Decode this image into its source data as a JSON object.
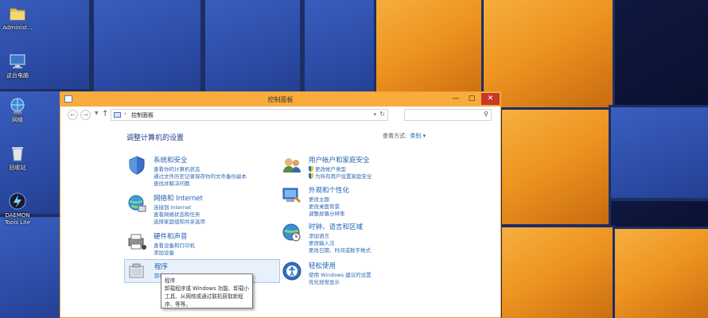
{
  "desktop": {
    "icons": [
      {
        "label": "Administ...",
        "icon": "folder-icon"
      },
      {
        "label": "这台电脑",
        "icon": "computer-icon"
      },
      {
        "label": "网络",
        "icon": "network-icon"
      },
      {
        "label": "回收站",
        "icon": "recycle-bin-icon"
      },
      {
        "label": "DAEMON Tools Lite",
        "icon": "daemon-tools-icon"
      }
    ]
  },
  "window": {
    "title": "控制面板",
    "buttons": {
      "minimize": "—",
      "maximize": "□",
      "close": "✕"
    },
    "address": {
      "path": "控制面板",
      "separator": "›"
    },
    "search": {
      "placeholder": ""
    },
    "heading": "调整计算机的设置",
    "view_by": {
      "label": "查看方式:",
      "value": "类别 ▾"
    },
    "categories": [
      {
        "title": "系统和安全",
        "icon": "shield-icon",
        "links": [
          "查看你的计算机状态",
          "通过文件历史记录保存你的文件备份副本",
          "查找并解决问题"
        ]
      },
      {
        "title": "网络和 Internet",
        "icon": "globe-network-icon",
        "links": [
          "连接到 Internet",
          "查看网络状态和任务",
          "选择家庭组和共享选项"
        ]
      },
      {
        "title": "硬件和声音",
        "icon": "printer-icon",
        "links": [
          "查看设备和打印机",
          "添加设备"
        ]
      },
      {
        "title": "程序",
        "icon": "programs-icon",
        "links": [
          "卸载程序"
        ]
      },
      {
        "title": "用户帐户和家庭安全",
        "icon": "users-icon",
        "links": [
          "更改帐户类型",
          "为所有用户设置家庭安全"
        ]
      },
      {
        "title": "外观和个性化",
        "icon": "appearance-icon",
        "links": [
          "更改主题",
          "更改桌面背景",
          "调整屏幕分辨率"
        ]
      },
      {
        "title": "时钟、语言和区域",
        "icon": "clock-globe-icon",
        "links": [
          "添加语言",
          "更改输入法",
          "更改日期、时间或数字格式"
        ]
      },
      {
        "title": "轻松使用",
        "icon": "ease-of-access-icon",
        "links": [
          "使用 Windows 建议的设置",
          "优化视觉显示"
        ]
      }
    ],
    "tooltip": {
      "title": "程序",
      "lines": [
        "卸载程序或 Windows 功能、卸载小",
        "工具、从网络或通过联机获取新程",
        "序、等等。"
      ]
    }
  }
}
